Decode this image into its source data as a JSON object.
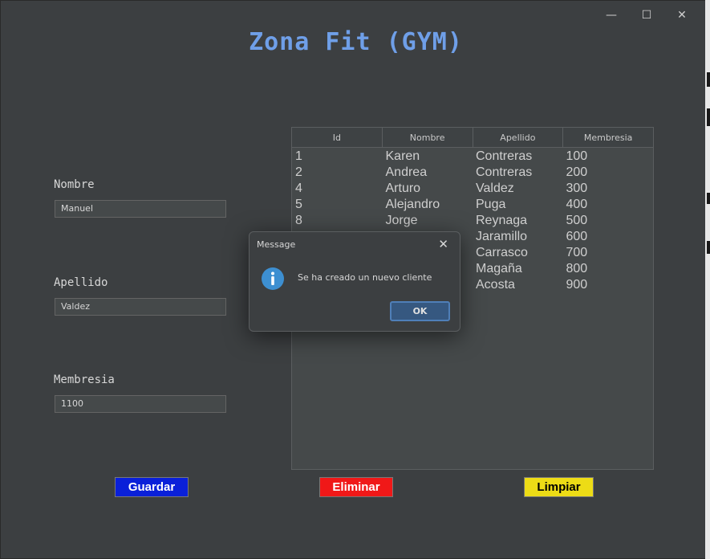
{
  "window": {
    "controls": {
      "minimize": "—",
      "maximize": "☐",
      "close": "✕"
    }
  },
  "app": {
    "title": "Zona Fit (GYM)"
  },
  "form": {
    "nombre": {
      "label": "Nombre",
      "value": "Manuel"
    },
    "apellido": {
      "label": "Apellido",
      "value": "Valdez"
    },
    "membresia": {
      "label": "Membresia",
      "value": "1100"
    }
  },
  "table": {
    "columns": [
      "Id",
      "Nombre",
      "Apellido",
      "Membresia"
    ],
    "rows": [
      [
        "1",
        "Karen",
        "Contreras",
        "100"
      ],
      [
        "2",
        "Andrea",
        "Contreras",
        "200"
      ],
      [
        "4",
        "Arturo",
        "Valdez",
        "300"
      ],
      [
        "5",
        "Alejandro",
        "Puga",
        "400"
      ],
      [
        "8",
        "Jorge",
        "Reynaga",
        "500"
      ],
      [
        "",
        "",
        "Jaramillo",
        "600"
      ],
      [
        "",
        "",
        "Carrasco",
        "700"
      ],
      [
        "",
        "",
        "Magaña",
        "800"
      ],
      [
        "",
        "",
        "Acosta",
        "900"
      ]
    ]
  },
  "buttons": {
    "guardar": "Guardar",
    "eliminar": "Eliminar",
    "limpiar": "Limpiar"
  },
  "dialog": {
    "title": "Message",
    "close": "✕",
    "icon": "info-icon",
    "message": "Se ha creado un nuevo cliente",
    "ok": "OK"
  },
  "colors": {
    "title": "#6f9fe8",
    "guardar": "#0a20d9",
    "eliminar": "#f01818",
    "limpiar": "#eddc16",
    "info": "#3d8fd1"
  }
}
